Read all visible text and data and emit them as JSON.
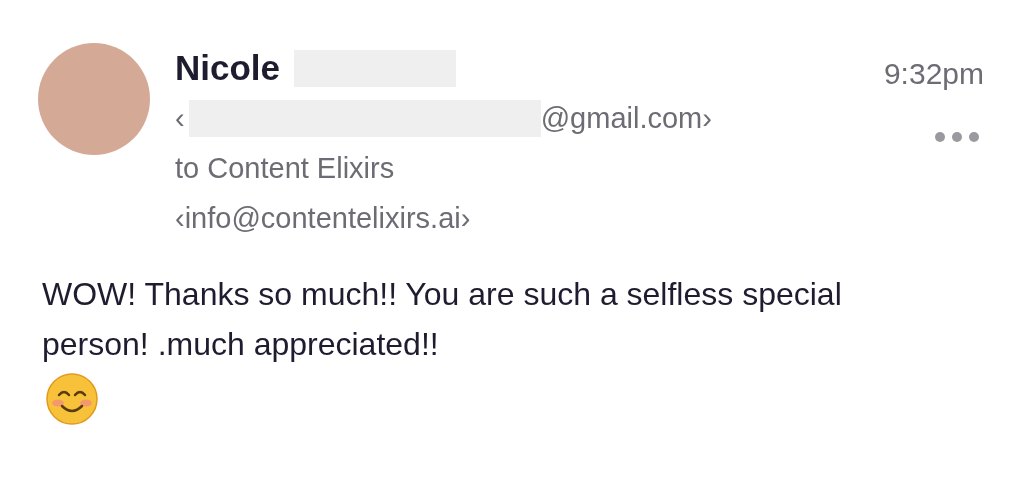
{
  "message": {
    "sender_name": "Nicole",
    "email_open": "‹",
    "email_domain": "@gmail.com›",
    "recipient_line": "to Content Elixirs",
    "recipient_email": "‹info@contentelixirs.ai›",
    "time": "9:32pm",
    "body": "WOW! Thanks so much!! You are such a selfless special person! .much appreciated!!"
  }
}
